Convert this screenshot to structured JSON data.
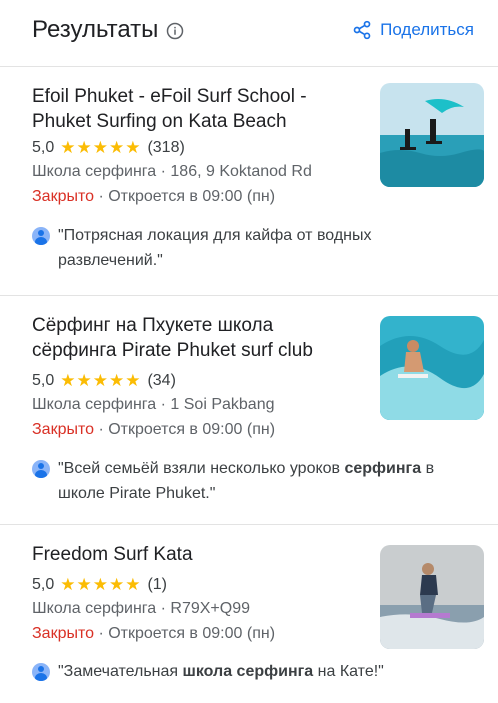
{
  "header": {
    "title": "Результаты",
    "share_label": "Поделиться"
  },
  "results": [
    {
      "name": "Efoil Phuket - eFoil Surf School - Phuket Surfing on Kata Beach",
      "rating": "5,0",
      "stars": "★★★★★",
      "reviews_count": "(318)",
      "info": "Школа серфинга · 186, 9 Koktanod Rd",
      "status": "Закрыто",
      "hours": " · Откроется в 09:00 (пн)",
      "review_before": "\"Потрясная локация для кайфа от водных развлечений.\"",
      "review_bold": "",
      "review_after": ""
    },
    {
      "name": "Сёрфинг на Пхукете школа сёрфинга Pirate Phuket surf club",
      "rating": "5,0",
      "stars": "★★★★★",
      "reviews_count": "(34)",
      "info": "Школа серфинга · 1 Soi Pakbang",
      "status": "Закрыто",
      "hours": " · Откроется в 09:00 (пн)",
      "review_before": "\"Всей семьёй взяли несколько уроков ",
      "review_bold": "серфинга",
      "review_after": " в школе Pirate Phuket.\""
    },
    {
      "name": "Freedom Surf Kata",
      "rating": "5,0",
      "stars": "★★★★★",
      "reviews_count": "(1)",
      "info": "Школа серфинга · R79X+Q99",
      "status": "Закрыто",
      "hours": " · Откроется в 09:00 (пн)",
      "review_before": "\"Замечательная ",
      "review_bold": "школа серфинга",
      "review_after": " на Кате!\""
    }
  ]
}
